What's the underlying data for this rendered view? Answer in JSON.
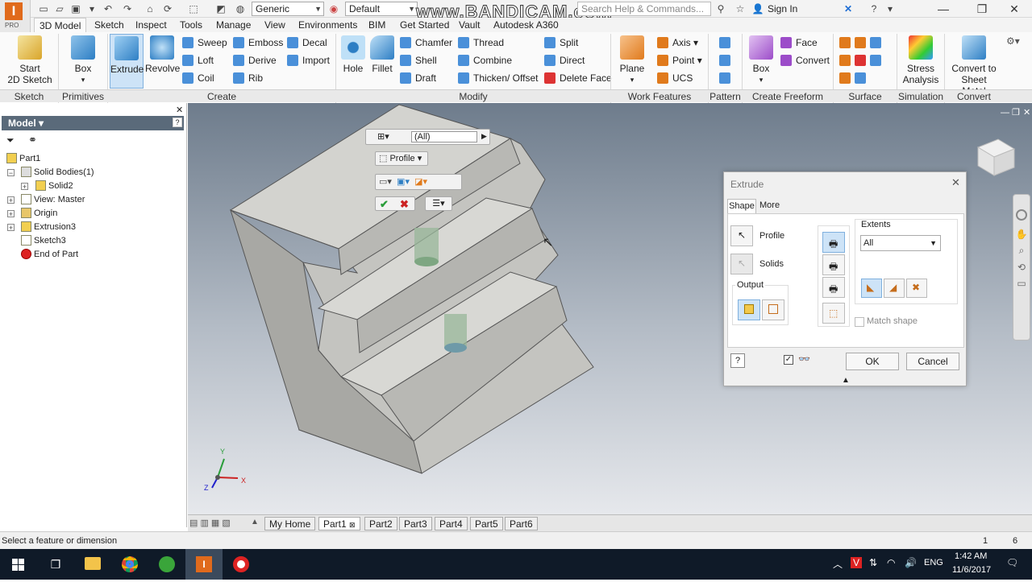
{
  "titlebar": {
    "app_label": "PRO",
    "material": "Generic",
    "appearance": "Default",
    "watermark": "www.BANDICAM.com",
    "search_placeholder": "Search Help & Commands...",
    "sign_in": "Sign In"
  },
  "menu_tabs": [
    "3D Model",
    "Sketch",
    "Inspect",
    "Tools",
    "Manage",
    "View",
    "Environments",
    "BIM",
    "Get Started",
    "Vault",
    "Autodesk A360"
  ],
  "ribbon": {
    "sketch": {
      "start_line1": "Start",
      "start_line2": "2D Sketch"
    },
    "primitives": {
      "box": "Box"
    },
    "create": {
      "extrude": "Extrude",
      "revolve": "Revolve",
      "sweep": "Sweep",
      "emboss": "Emboss",
      "decal": "Decal",
      "loft": "Loft",
      "derive": "Derive",
      "import": "Import",
      "coil": "Coil",
      "rib": "Rib"
    },
    "modify": {
      "hole": "Hole",
      "fillet": "Fillet",
      "chamfer": "Chamfer",
      "thread": "Thread",
      "split": "Split",
      "shell": "Shell",
      "combine": "Combine",
      "direct": "Direct",
      "draft": "Draft",
      "thicken": "Thicken/ Offset",
      "delete_face": "Delete Face"
    },
    "work": {
      "plane": "Plane",
      "axis": "Axis",
      "point": "Point",
      "ucs": "UCS"
    },
    "freeform": {
      "box": "Box",
      "face": "Face",
      "convert": "Convert"
    },
    "simulation": {
      "line1": "Stress",
      "line2": "Analysis"
    },
    "convert": {
      "line1": "Convert to",
      "line2": "Sheet Metal"
    },
    "panels": [
      "Sketch",
      "Primitives",
      "Create",
      "Modify",
      "Work Features",
      "Pattern",
      "Create Freeform",
      "Surface",
      "Simulation",
      "Convert"
    ]
  },
  "browser": {
    "title": "Model",
    "nodes": [
      "Part1",
      "Solid Bodies(1)",
      "Solid2",
      "View: Master",
      "Origin",
      "Extrusion3",
      "Sketch3",
      "End of Part"
    ]
  },
  "minitoolbar": {
    "filter": "(All)",
    "profile": "Profile"
  },
  "dialog": {
    "title": "Extrude",
    "tab_shape": "Shape",
    "tab_more": "More",
    "profile": "Profile",
    "solids": "Solids",
    "output": "Output",
    "extents": "Extents",
    "extents_value": "All",
    "match_shape": "Match shape",
    "ok": "OK",
    "cancel": "Cancel"
  },
  "doc_tabs": [
    "My Home",
    "Part1",
    "Part2",
    "Part3",
    "Part4",
    "Part5",
    "Part6"
  ],
  "status": {
    "message": "Select a feature or dimension",
    "count1": "1",
    "count2": "6"
  },
  "taskbar": {
    "lang": "ENG",
    "time": "1:42 AM",
    "date": "11/6/2017"
  },
  "colors": {
    "accent": "#4a90d9",
    "brand": "#e06a1c",
    "model_face": "#c8c8c4",
    "taskbar": "#0f1a28"
  }
}
